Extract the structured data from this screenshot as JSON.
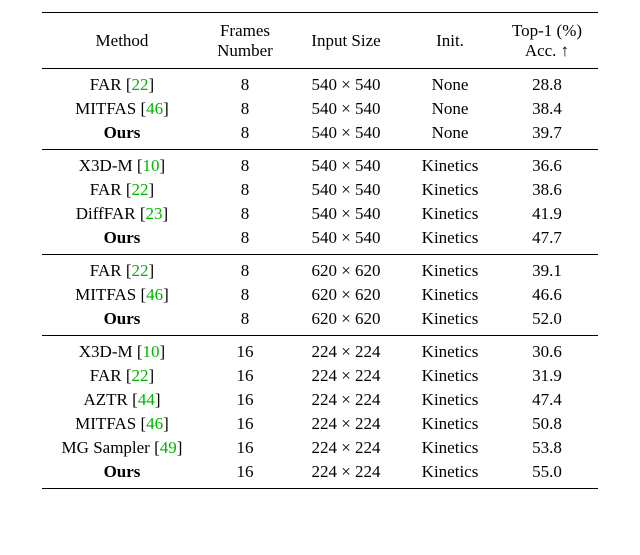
{
  "headers": {
    "method": "Method",
    "frames_l1": "Frames",
    "frames_l2": "Number",
    "input": "Input Size",
    "init": "Init.",
    "acc_l1": "Top-1 (%)",
    "acc_l2": "Acc. ↑"
  },
  "mult": "×",
  "groups": [
    {
      "rows": [
        {
          "method": "FAR",
          "ref": "22",
          "frames": "8",
          "w": "540",
          "h": "540",
          "init": "None",
          "acc": "28.8",
          "bold": false
        },
        {
          "method": "MITFAS",
          "ref": "46",
          "frames": "8",
          "w": "540",
          "h": "540",
          "init": "None",
          "acc": "38.4",
          "bold": false
        },
        {
          "method": "Ours",
          "ref": "",
          "frames": "8",
          "w": "540",
          "h": "540",
          "init": "None",
          "acc": "39.7",
          "bold": true
        }
      ]
    },
    {
      "rows": [
        {
          "method": "X3D-M",
          "ref": "10",
          "frames": "8",
          "w": "540",
          "h": "540",
          "init": "Kinetics",
          "acc": "36.6",
          "bold": false
        },
        {
          "method": "FAR",
          "ref": "22",
          "frames": "8",
          "w": "540",
          "h": "540",
          "init": "Kinetics",
          "acc": "38.6",
          "bold": false
        },
        {
          "method": "DiffFAR",
          "ref": "23",
          "frames": "8",
          "w": "540",
          "h": "540",
          "init": "Kinetics",
          "acc": "41.9",
          "bold": false
        },
        {
          "method": "Ours",
          "ref": "",
          "frames": "8",
          "w": "540",
          "h": "540",
          "init": "Kinetics",
          "acc": "47.7",
          "bold": true
        }
      ]
    },
    {
      "rows": [
        {
          "method": "FAR",
          "ref": "22",
          "frames": "8",
          "w": "620",
          "h": "620",
          "init": "Kinetics",
          "acc": "39.1",
          "bold": false
        },
        {
          "method": "MITFAS",
          "ref": "46",
          "frames": "8",
          "w": "620",
          "h": "620",
          "init": "Kinetics",
          "acc": "46.6",
          "bold": false
        },
        {
          "method": "Ours",
          "ref": "",
          "frames": "8",
          "w": "620",
          "h": "620",
          "init": "Kinetics",
          "acc": "52.0",
          "bold": true
        }
      ]
    },
    {
      "rows": [
        {
          "method": "X3D-M",
          "ref": "10",
          "frames": "16",
          "w": "224",
          "h": "224",
          "init": "Kinetics",
          "acc": "30.6",
          "bold": false
        },
        {
          "method": "FAR",
          "ref": "22",
          "frames": "16",
          "w": "224",
          "h": "224",
          "init": "Kinetics",
          "acc": "31.9",
          "bold": false
        },
        {
          "method": "AZTR",
          "ref": "44",
          "frames": "16",
          "w": "224",
          "h": "224",
          "init": "Kinetics",
          "acc": "47.4",
          "bold": false
        },
        {
          "method": "MITFAS",
          "ref": "46",
          "frames": "16",
          "w": "224",
          "h": "224",
          "init": "Kinetics",
          "acc": "50.8",
          "bold": false
        },
        {
          "method": "MG Sampler",
          "ref": "49",
          "frames": "16",
          "w": "224",
          "h": "224",
          "init": "Kinetics",
          "acc": "53.8",
          "bold": false
        },
        {
          "method": "Ours",
          "ref": "",
          "frames": "16",
          "w": "224",
          "h": "224",
          "init": "Kinetics",
          "acc": "55.0",
          "bold": true
        }
      ]
    }
  ]
}
